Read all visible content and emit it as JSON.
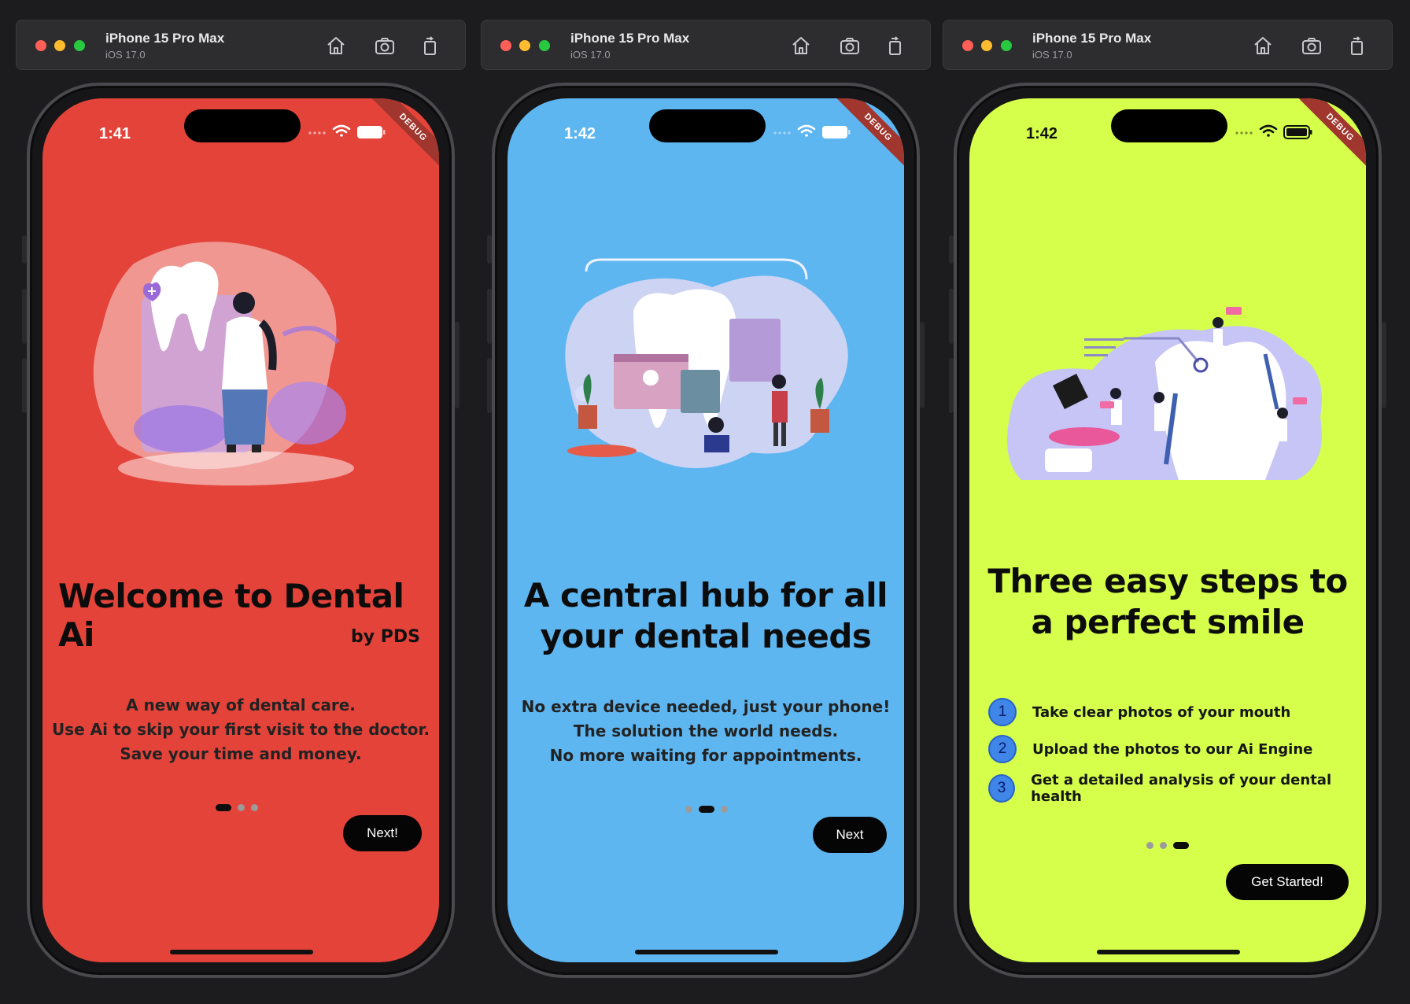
{
  "simulators": [
    {
      "device": "iPhone 15 Pro Max",
      "os": "iOS 17.0",
      "time": "1:41",
      "bg": "#e4433a",
      "debug": "DEBUG",
      "title_line1": "Welcome to Dental Ai",
      "title_line2": "",
      "byline": "by PDS",
      "body": [
        "A new way of dental care.",
        "Use Ai to skip your first visit to the doctor.",
        "Save your time and money."
      ],
      "active_page": 0,
      "button": "Next!"
    },
    {
      "device": "iPhone 15 Pro Max",
      "os": "iOS 17.0",
      "time": "1:42",
      "bg": "#5eb6f1",
      "debug": "DEBUG",
      "title_line1": "A central hub for all",
      "title_line2": "your dental needs",
      "body": [
        "No extra device needed, just your phone!",
        "The solution the world needs.",
        "No more waiting for appointments."
      ],
      "active_page": 1,
      "button": "Next"
    },
    {
      "device": "iPhone 15 Pro Max",
      "os": "iOS 17.0",
      "time": "1:42",
      "bg": "#d6ff4c",
      "debug": "DEBUG",
      "title_line1": "Three easy steps to",
      "title_line2": "a perfect smile",
      "steps": [
        {
          "num": "1",
          "text": "Take clear photos of your mouth"
        },
        {
          "num": "2",
          "text": "Upload the photos to our Ai Engine"
        },
        {
          "num": "3",
          "text": "Get a detailed analysis of your dental health"
        }
      ],
      "active_page": 2,
      "button": "Get Started!"
    }
  ],
  "icons": [
    "home-icon",
    "camera-icon",
    "rotate-icon",
    "wifi-icon",
    "battery-icon"
  ]
}
